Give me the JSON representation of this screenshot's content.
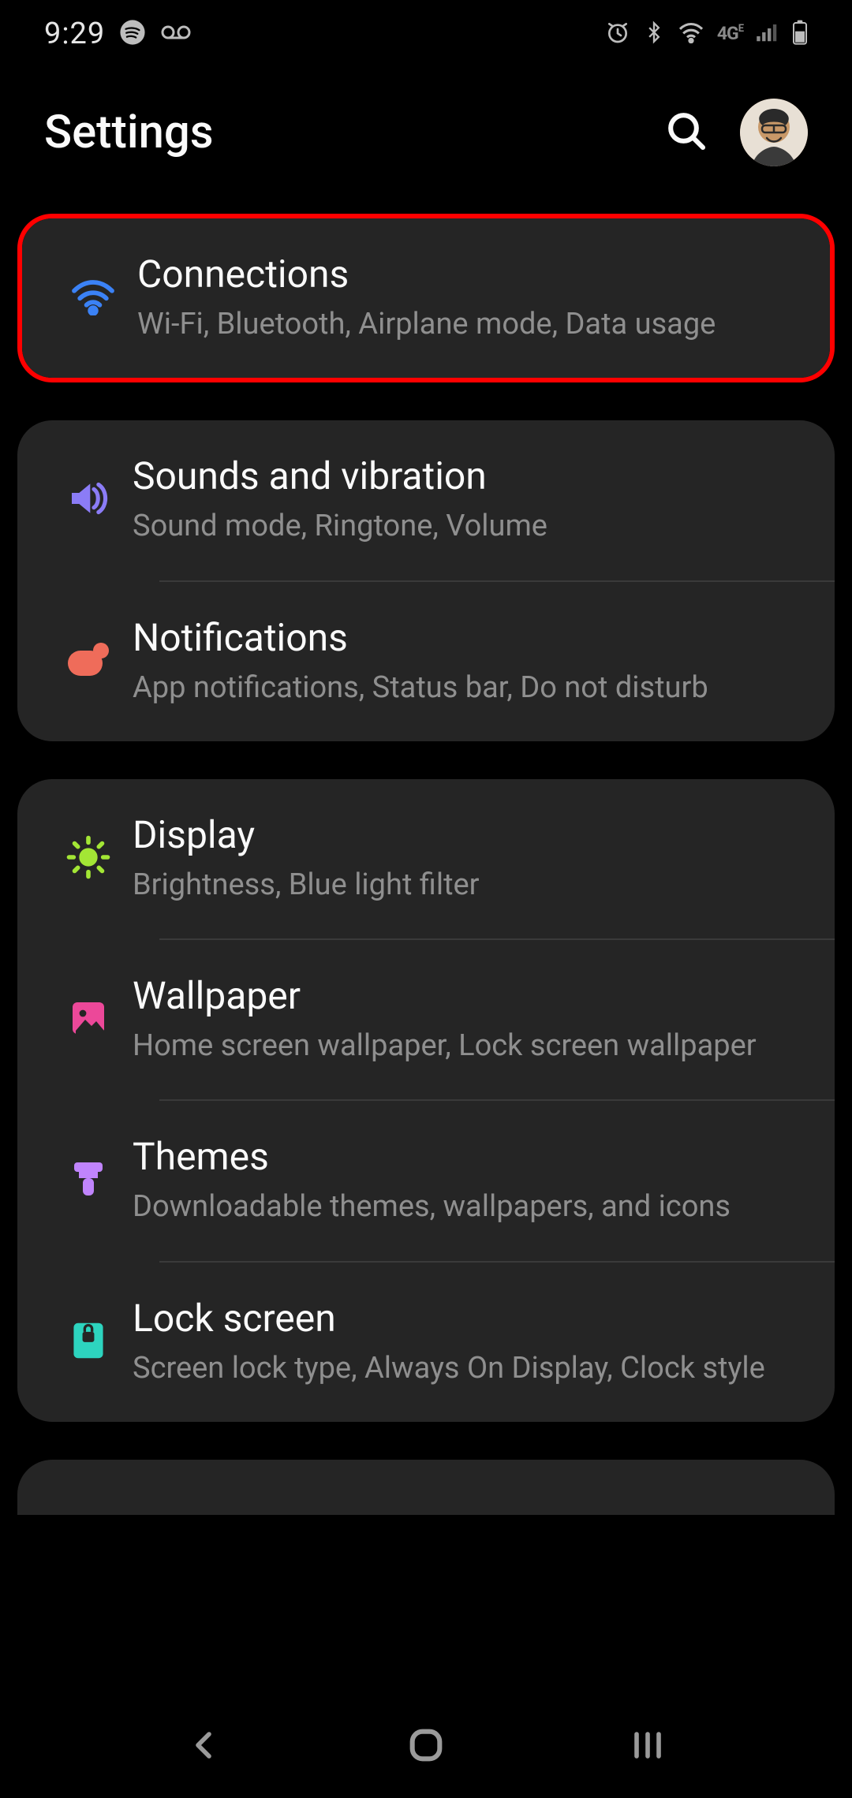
{
  "status": {
    "time": "9:29",
    "icons_left": [
      "spotify-icon",
      "voicemail-icon"
    ],
    "icons_right": [
      "alarm-icon",
      "bluetooth-icon",
      "wifi-icon",
      "4g-icon",
      "signal-icon",
      "battery-icon"
    ]
  },
  "header": {
    "title": "Settings"
  },
  "groups": [
    {
      "highlight": true,
      "items": [
        {
          "icon": "wifi",
          "color": "#3b82f6",
          "title": "Connections",
          "subtitle": "Wi-Fi, Bluetooth, Airplane mode, Data usage"
        }
      ]
    },
    {
      "items": [
        {
          "icon": "sound",
          "color": "#8b7cf6",
          "title": "Sounds and vibration",
          "subtitle": "Sound mode, Ringtone, Volume"
        },
        {
          "icon": "notification",
          "color": "#ef6c5a",
          "title": "Notifications",
          "subtitle": "App notifications, Status bar, Do not disturb"
        }
      ]
    },
    {
      "items": [
        {
          "icon": "display",
          "color": "#a3e635",
          "title": "Display",
          "subtitle": "Brightness, Blue light filter"
        },
        {
          "icon": "wallpaper",
          "color": "#ec4899",
          "title": "Wallpaper",
          "subtitle": "Home screen wallpaper, Lock screen wallpaper"
        },
        {
          "icon": "themes",
          "color": "#c084fc",
          "title": "Themes",
          "subtitle": "Downloadable themes, wallpapers, and icons"
        },
        {
          "icon": "lock",
          "color": "#2dd4bf",
          "title": "Lock screen",
          "subtitle": "Screen lock type, Always On Display, Clock style"
        }
      ]
    }
  ]
}
